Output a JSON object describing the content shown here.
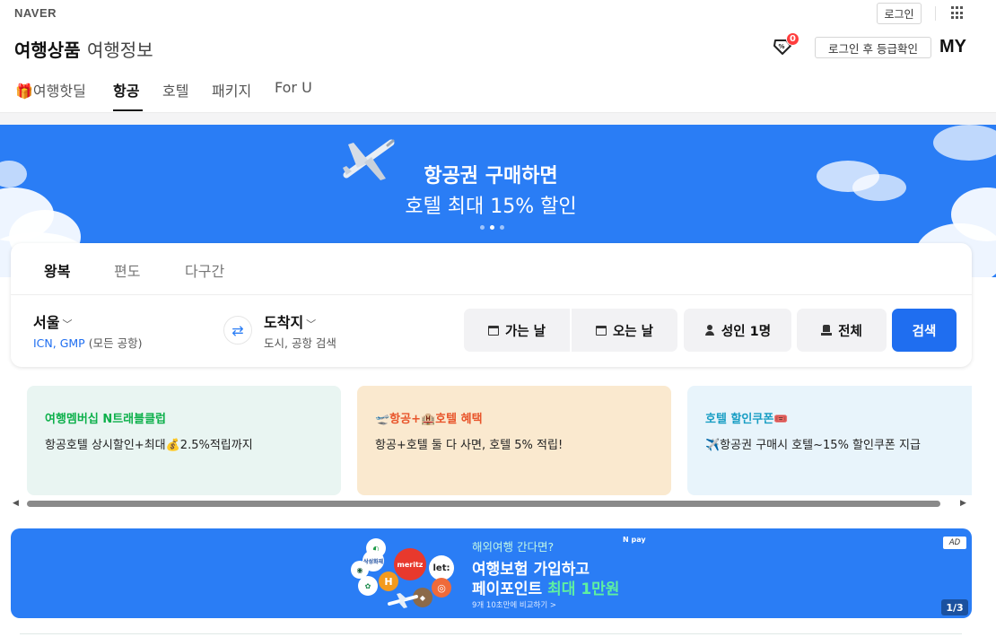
{
  "header": {
    "logo": "NAVER",
    "login_label": "로그인",
    "title_main": "여행상품",
    "title_sub": "여행정보",
    "coupon_count": "0",
    "grade_label": "로그인 후 등급확인",
    "my_label": "MY"
  },
  "nav": {
    "tabs": [
      {
        "label": "여행핫딜",
        "icon": "gift-icon"
      },
      {
        "label": "항공",
        "active": true
      },
      {
        "label": "호텔"
      },
      {
        "label": "패키지"
      },
      {
        "label": "For U"
      }
    ]
  },
  "banner": {
    "line1": "항공권 구매하면",
    "line2": "호텔 최대 15% 할인",
    "slide_count": 3,
    "active_slide": 2
  },
  "search": {
    "trip_tabs": [
      {
        "label": "왕복",
        "active": true
      },
      {
        "label": "편도"
      },
      {
        "label": "다구간"
      }
    ],
    "from_city": "서울",
    "from_codes": "ICN, GMP",
    "from_note": "(모든 공항)",
    "to_city": "도착지",
    "to_placeholder": "도시, 공항 검색",
    "depart_label": "가는 날",
    "return_label": "오는 날",
    "passengers_label": "성인 1명",
    "cabin_label": "전체",
    "search_label": "검색"
  },
  "promos": [
    {
      "title": "여행멤버십 N트래블클럽",
      "desc": "항공호텔 상시할인+최대💰2.5%적립까지",
      "title_color": "#0db04b",
      "bg": "#e9f5f2"
    },
    {
      "title": "🛫항공+🏨호텔 혜택",
      "desc": "항공+호텔 둘 다 사면, 호텔 5% 적립!",
      "title_color": "#e8552b",
      "bg": "#fae9cf"
    },
    {
      "title": "호텔 할인쿠폰🎟️",
      "desc": "✈️항공권 구매시 호텔~15% 할인쿠폰 지급",
      "title_color": "#1a9ec4",
      "bg": "#e8f4fb"
    }
  ],
  "ad": {
    "line1": "해외여행 간다면?",
    "line2": "여행보험 가입하고",
    "line3_prefix": "페이포인트 ",
    "line3_highlight": "최대 1만원",
    "line4": "9개 10초만에 비교하기 >",
    "pay_logo": "N pay",
    "tag": "AD",
    "page": "1/3",
    "logos": [
      "meritz",
      "let:",
      "삼성화재"
    ]
  },
  "colors": {
    "brand_blue": "#2a7df5",
    "search_button": "#1f6ef0"
  }
}
